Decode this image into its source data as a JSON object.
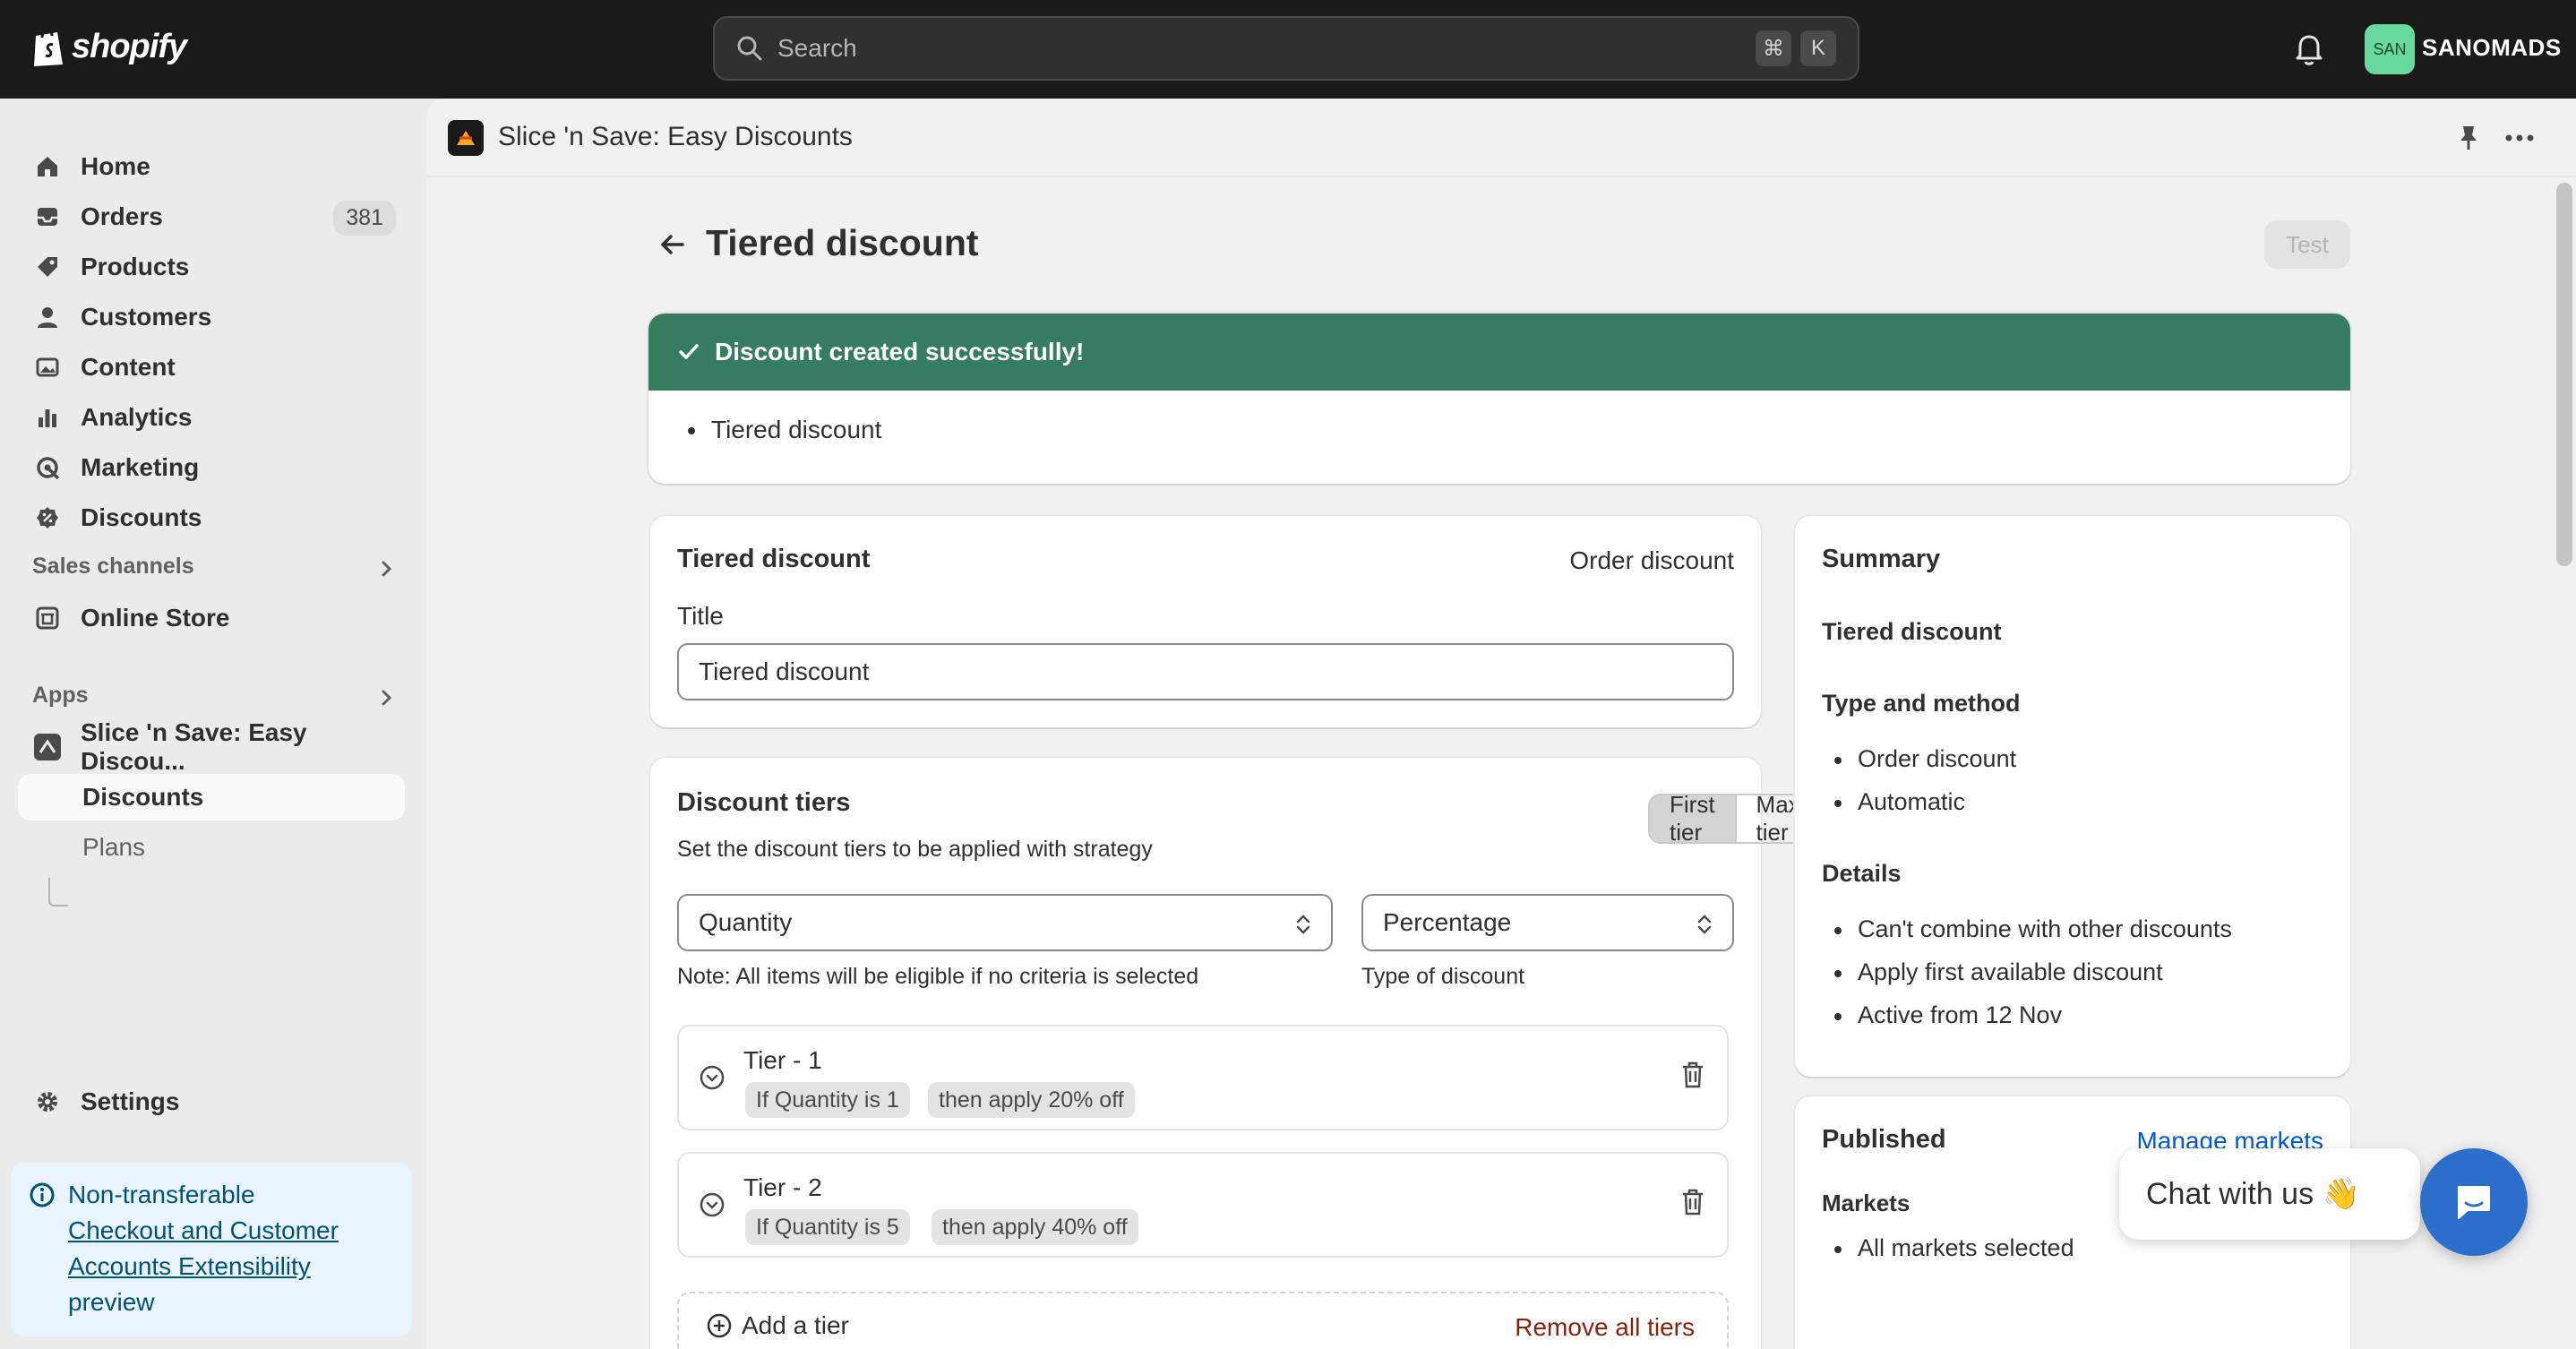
{
  "topbar": {
    "logo_text": "shopify",
    "search_placeholder": "Search",
    "shortcut_keys": [
      "⌘",
      "K"
    ],
    "avatar_initials": "SAN",
    "store_name": "SANOMADS"
  },
  "sidebar": {
    "items": [
      {
        "label": "Home",
        "icon": "home-icon"
      },
      {
        "label": "Orders",
        "icon": "inbox-icon",
        "badge": "381"
      },
      {
        "label": "Products",
        "icon": "tag-icon"
      },
      {
        "label": "Customers",
        "icon": "person-icon"
      },
      {
        "label": "Content",
        "icon": "image-icon"
      },
      {
        "label": "Analytics",
        "icon": "bar-chart-icon"
      },
      {
        "label": "Marketing",
        "icon": "target-icon"
      },
      {
        "label": "Discounts",
        "icon": "discount-icon"
      }
    ],
    "sales_channels_heading": "Sales channels",
    "online_store": "Online Store",
    "apps_heading": "Apps",
    "app_name": "Slice 'n Save: Easy Discou...",
    "app_sub_items": [
      "Discounts",
      "Plans"
    ],
    "settings": "Settings",
    "info": {
      "prefix": "Non-transferable",
      "link": "Checkout and Customer Accounts Extensibility",
      "suffix": "preview"
    }
  },
  "app_bar": {
    "title": "Slice 'n Save: Easy Discounts"
  },
  "page": {
    "title": "Tiered discount",
    "test_button": "Test"
  },
  "banner": {
    "title": "Discount created successfully!",
    "item": "Tiered discount"
  },
  "discount_card": {
    "heading": "Tiered discount",
    "type": "Order discount",
    "title_label": "Title",
    "title_value": "Tiered discount"
  },
  "tiers_card": {
    "heading": "Discount tiers",
    "description": "Set the discount tiers to be applied with strategy",
    "segment": {
      "first": "First tier",
      "max": "Maximum tier"
    },
    "criteria_select": "Quantity",
    "criteria_note": "Note: All items will be eligible if no criteria is selected",
    "type_select": "Percentage",
    "type_note": "Type of discount",
    "tiers": [
      {
        "name": "Tier - 1",
        "condition": "If Quantity is 1",
        "action": "then apply 20% off"
      },
      {
        "name": "Tier - 2",
        "condition": "If Quantity is 5",
        "action": "then apply 40% off"
      }
    ],
    "add_tier": "Add a tier",
    "remove_all": "Remove all tiers"
  },
  "summary": {
    "heading": "Summary",
    "name": "Tiered discount",
    "type_heading": "Type and method",
    "type_items": [
      "Order discount",
      "Automatic"
    ],
    "details_heading": "Details",
    "details_items": [
      "Can't combine with other discounts",
      "Apply first available discount",
      "Active from 12 Nov"
    ]
  },
  "published": {
    "heading": "Published",
    "manage_link": "Manage markets",
    "markets_heading": "Markets",
    "markets_value": "All markets selected"
  },
  "chat": {
    "label": "Chat with us 👋"
  },
  "colors": {
    "topbar": "#1a1a1a",
    "success": "#367d5f",
    "link": "#005bd3",
    "danger": "#8e1f0b",
    "chat": "#2c6ecb"
  }
}
